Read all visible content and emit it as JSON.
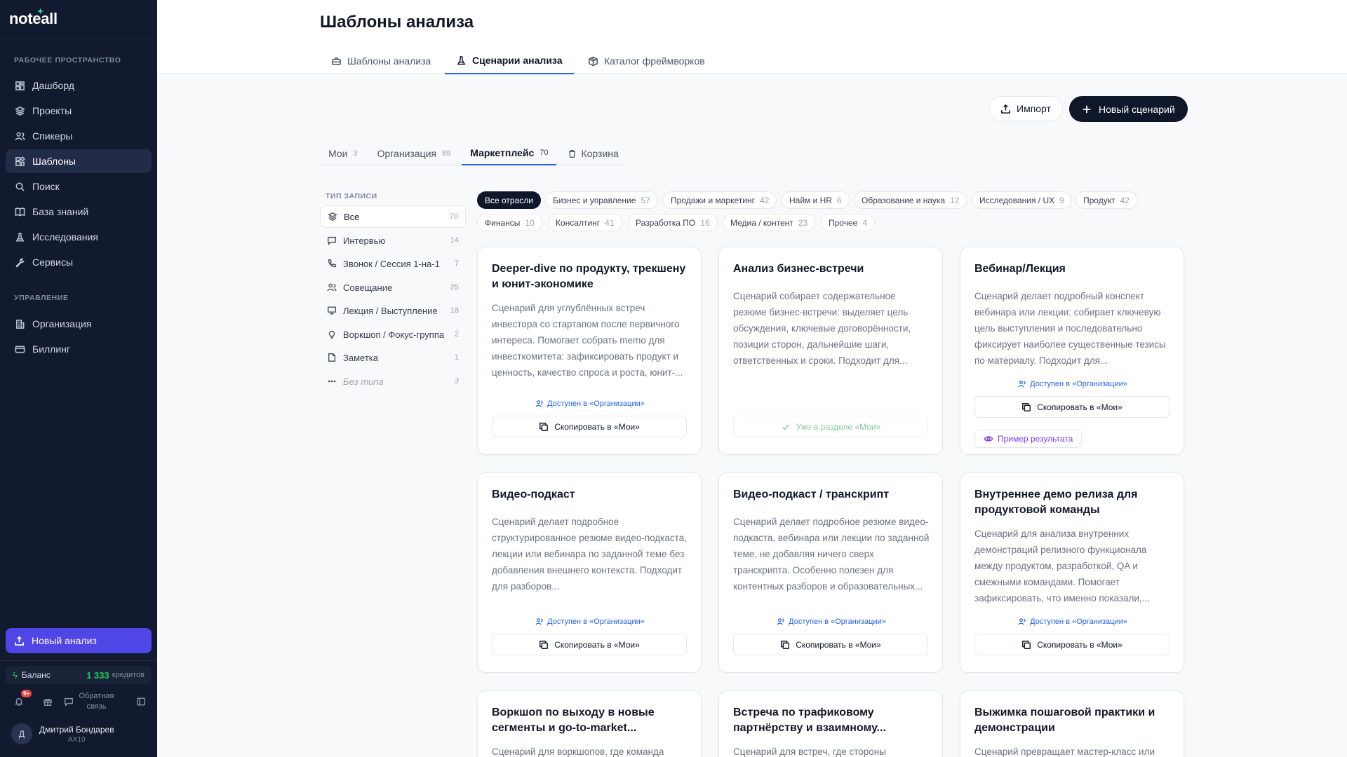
{
  "app": {
    "logo": "noteall"
  },
  "sidebar": {
    "workspace_title": "РАБОЧЕЕ ПРОСТРАНСТВО",
    "workspace_items": [
      {
        "label": "Дашборд",
        "icon": "dashboard-icon"
      },
      {
        "label": "Проекты",
        "icon": "layers-icon"
      },
      {
        "label": "Спикеры",
        "icon": "users-icon"
      },
      {
        "label": "Шаблоны",
        "icon": "templates-icon",
        "active": true
      },
      {
        "label": "Поиск",
        "icon": "search-icon"
      },
      {
        "label": "База знаний",
        "icon": "book-icon"
      },
      {
        "label": "Исследования",
        "icon": "flask-icon"
      },
      {
        "label": "Сервисы",
        "icon": "wrench-icon"
      }
    ],
    "manage_title": "УПРАВЛЕНИЕ",
    "manage_items": [
      {
        "label": "Организация",
        "icon": "building-icon"
      },
      {
        "label": "Биллинг",
        "icon": "card-icon"
      }
    ],
    "new_analysis_label": "Новый анализ",
    "balance_label": "Баланс",
    "balance_amount": "1 333",
    "balance_unit": "кредитов",
    "notifications_badge": "9+",
    "feedback_label": "Обратная связь",
    "user": {
      "initial": "Д",
      "name": "Дмитрий Бондарев",
      "org": "AX10"
    }
  },
  "header": {
    "title": "Шаблоны анализа",
    "tabs": [
      {
        "label": "Шаблоны анализа",
        "icon": "briefcase-icon"
      },
      {
        "label": "Сценарии анализа",
        "icon": "flask-icon",
        "active": true
      },
      {
        "label": "Каталог фреймворков",
        "icon": "box-icon"
      }
    ]
  },
  "actions": {
    "import_label": "Импорт",
    "new_scenario_label": "Новый сценарий"
  },
  "subtabs": [
    {
      "label": "Мои",
      "count": "3"
    },
    {
      "label": "Организация",
      "count": "89"
    },
    {
      "label": "Маркетплейс",
      "count": "70",
      "active": true
    },
    {
      "label": "Корзина",
      "count": ""
    }
  ],
  "filters": {
    "title": "ТИП ЗАПИСИ",
    "items": [
      {
        "label": "Все",
        "count": "70",
        "icon": "layers-icon",
        "active": true
      },
      {
        "label": "Интервью",
        "count": "14",
        "icon": "chat-icon"
      },
      {
        "label": "Звонок / Сессия 1-на-1",
        "count": "7",
        "icon": "phone-icon"
      },
      {
        "label": "Совещание",
        "count": "25",
        "icon": "users-icon"
      },
      {
        "label": "Лекция / Выступление",
        "count": "18",
        "icon": "presentation-icon"
      },
      {
        "label": "Воркшоп / Фокус-группа",
        "count": "2",
        "icon": "bulb-icon"
      },
      {
        "label": "Заметка",
        "count": "1",
        "icon": "note-icon"
      },
      {
        "label": "Без типа",
        "count": "3",
        "icon": "dots-icon",
        "muted": true
      }
    ]
  },
  "industries": [
    {
      "label": "Все отрасли",
      "count": "",
      "active": true
    },
    {
      "label": "Бизнес и управление",
      "count": "57"
    },
    {
      "label": "Продажи и маркетинг",
      "count": "42"
    },
    {
      "label": "Найм и HR",
      "count": "6"
    },
    {
      "label": "Образование и наука",
      "count": "12"
    },
    {
      "label": "Исследования / UX",
      "count": "9"
    },
    {
      "label": "Продукт",
      "count": "42"
    },
    {
      "label": "Финансы",
      "count": "10"
    },
    {
      "label": "Консалтинг",
      "count": "41"
    },
    {
      "label": "Разработка ПО",
      "count": "16"
    },
    {
      "label": "Медиа / контент",
      "count": "23"
    },
    {
      "label": "Прочее",
      "count": "4"
    }
  ],
  "cards": [
    {
      "title": "Deeper-dive по продукту, трекшену и юнит-экономике",
      "description": "Сценарий для углублённых встреч инвестора со стартапом после первичного интереса. Помогает собрать memo для инвесткомитета: зафиксировать продукт и ценность, качество спроса и роста, юнит-...",
      "access": "Доступен в «Организации»",
      "button": "Скопировать в «Мои»"
    },
    {
      "title": "Анализ бизнес-встречи",
      "description": "Сценарий собирает содержательное резюме бизнес-встречи: выделяет цель обсуждения, ключевые договорённости, позиции сторон, дальнейшие шаги, ответственных и сроки. Подходит для...",
      "access": "",
      "button": "Уже в разделе «Мои»"
    },
    {
      "title": "Вебинар/Лекция",
      "description": "Сценарий делает подробный конспект вебинара или лекции: собирает ключевую цель выступления и последовательно фиксирует наиболее существенные тезисы по материалу. Подходит для...",
      "access": "Доступен в «Организации»",
      "button": "Скопировать в «Мои»",
      "example": "Пример результата"
    },
    {
      "title": "Видео-подкаст",
      "description": "Сценарий делает подробное структурированное резюме видео-подкаста, лекции или вебинара по заданной теме без добавления внешнего контекста. Подходит для разборов...",
      "access": "Доступен в «Организации»",
      "button": "Скопировать в «Мои»"
    },
    {
      "title": "Видео-подкаст / транскрипт",
      "description": "Сценарий делает подробное резюме видео-подкаста, вебинара или лекции по заданной теме, не добавляя ничего сверх транскрипта. Особенно полезен для контентных разборов и образовательных...",
      "access": "Доступен в «Организации»",
      "button": "Скопировать в «Мои»"
    },
    {
      "title": "Внутреннее демо релиза для продуктовой команды",
      "description": "Сценарий для анализа внутренних демонстраций релизного функционала между продуктом, разработкой, QA и смежными командами. Помогает зафиксировать, что именно показали,...",
      "access": "Доступен в «Организации»",
      "button": "Скопировать в «Мои»"
    },
    {
      "title": "Воркшоп по выходу в новые сегменты и go-to-market...",
      "description": "Сценарий для воркшопов, где команда",
      "access": "",
      "button": ""
    },
    {
      "title": "Встреча по трафиковому партнёрству и взаимному...",
      "description": "Сценарий для встреч, где стороны",
      "access": "",
      "button": ""
    },
    {
      "title": "Выжимка пошаговой практики и демонстрации",
      "description": "Сценарий превращает мастер-класс или",
      "access": "",
      "button": ""
    }
  ]
}
